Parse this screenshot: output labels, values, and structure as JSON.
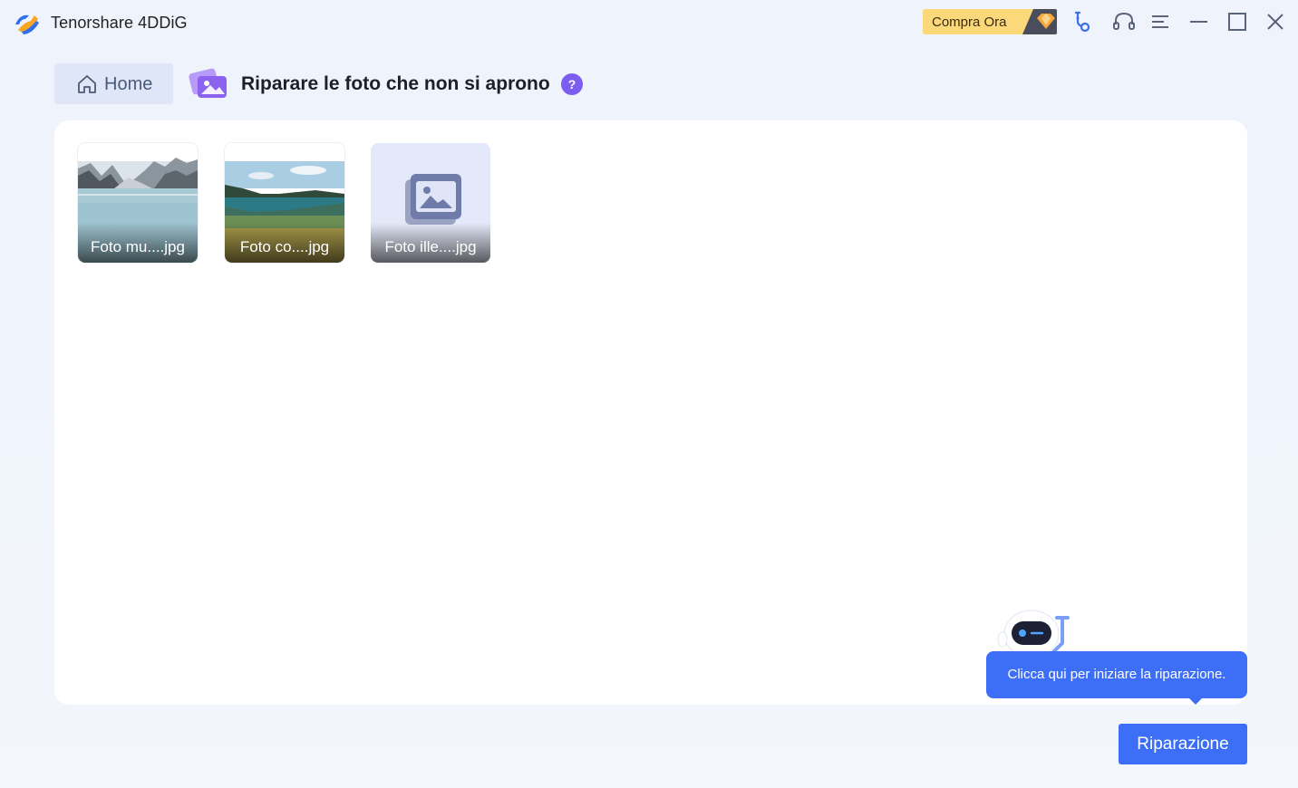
{
  "app": {
    "title": "Tenorshare 4DDiG"
  },
  "titlebar": {
    "buy_label": "Compra Ora",
    "buy_icon": "diamond-icon",
    "icons": [
      "key-icon",
      "headset-icon",
      "menu-icon",
      "minimize-icon",
      "maximize-icon",
      "close-icon"
    ]
  },
  "header": {
    "home_label": "Home",
    "page_title": "Riparare le foto che non si aprono",
    "help_label": "?"
  },
  "files": [
    {
      "caption": "Foto mu....jpg",
      "kind": "mountain-lake-photo"
    },
    {
      "caption": "Foto co....jpg",
      "kind": "coast-lake-photo"
    },
    {
      "caption": "Foto ille....jpg",
      "kind": "placeholder-image-icon"
    }
  ],
  "tooltip": {
    "text": "Clicca qui per iniziare la riparazione."
  },
  "actions": {
    "repair_label": "Riparazione"
  },
  "colors": {
    "accent": "#3d6ef7",
    "help": "#7d5cf0",
    "buy_bg": "#fbd97b"
  }
}
